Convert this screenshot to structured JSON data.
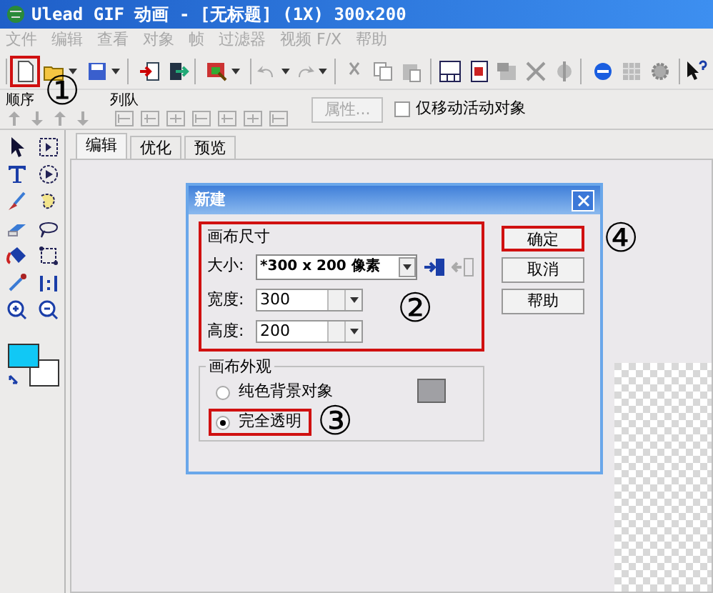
{
  "window": {
    "title": "Ulead GIF 动画 - [无标题] (1X) 300x200"
  },
  "menu": [
    {
      "label": "文件",
      "disabled": true
    },
    {
      "label": "编辑",
      "disabled": true
    },
    {
      "label": "查看",
      "disabled": true
    },
    {
      "label": "对象",
      "disabled": true
    },
    {
      "label": "帧",
      "disabled": true
    },
    {
      "label": "过滤器",
      "disabled": true
    },
    {
      "label": "视频 F/X",
      "disabled": true
    },
    {
      "label": "帮助",
      "disabled": true
    }
  ],
  "toolbar": {
    "new_button_highlighted": true
  },
  "sequence_bar": {
    "order_label": "顺序",
    "queue_label": "列队",
    "properties_button": {
      "label": "属性...",
      "disabled": true
    },
    "move_active_only": {
      "label": "仅移动活动对象",
      "checked": false
    }
  },
  "tabs": [
    {
      "label": "编辑",
      "selected": true
    },
    {
      "label": "优化",
      "selected": false
    },
    {
      "label": "预览",
      "selected": false
    }
  ],
  "dialog": {
    "title": "新建",
    "size_group": {
      "label": "画布尺寸",
      "highlighted": true,
      "size_label": "大小:",
      "size_value": "*300 x 200 像素",
      "width_label": "宽度:",
      "width_value": "300",
      "height_label": "高度:",
      "height_value": "200"
    },
    "appearance_group": {
      "label": "画布外观",
      "options": [
        {
          "label": "纯色背景对象",
          "selected": false,
          "highlighted": false
        },
        {
          "label": "完全透明",
          "selected": true,
          "highlighted": true
        }
      ]
    },
    "buttons": [
      {
        "label": "确定",
        "highlighted": true
      },
      {
        "label": "取消",
        "highlighted": false
      },
      {
        "label": "帮助",
        "highlighted": false
      }
    ]
  },
  "annotations": [
    {
      "label": "①"
    },
    {
      "label": "②"
    },
    {
      "label": "③"
    },
    {
      "label": "④"
    }
  ]
}
